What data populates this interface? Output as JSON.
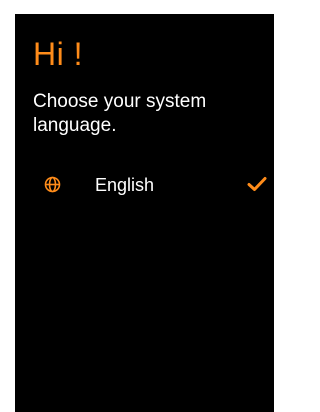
{
  "colors": {
    "accent": "#ff8c1a",
    "text": "#ffffff",
    "background": "#000000"
  },
  "header": {
    "title": "Hi !",
    "subtitle": "Choose your system language."
  },
  "languages": [
    {
      "label": "English",
      "icon": "globe-icon",
      "selected": true,
      "selected_icon": "checkmark-icon"
    }
  ]
}
